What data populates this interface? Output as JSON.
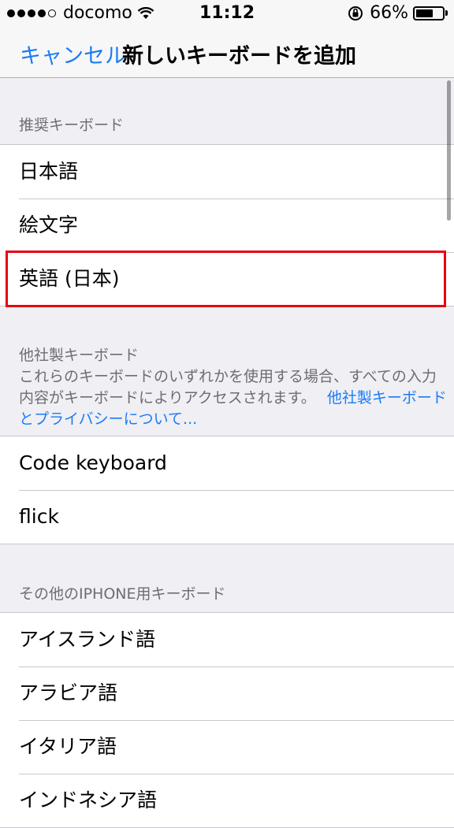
{
  "status_bar": {
    "carrier": "docomo",
    "time": "11:12",
    "battery_percent": "66%",
    "battery_level": 0.66,
    "signal_dots_filled": 4,
    "signal_dots_total": 5
  },
  "nav": {
    "cancel_label": "キャンセル",
    "title": "新しいキーボードを追加"
  },
  "recommended": {
    "header": "推奨キーボード",
    "items": [
      {
        "label": "日本語"
      },
      {
        "label": "絵文字"
      },
      {
        "label": "英語 (日本)"
      }
    ]
  },
  "third_party": {
    "header": "他社製キーボード",
    "description_line1": "これらのキーボードのいずれかを使用する場合、すべての入力",
    "description_line2": "内容がキーボードによりアクセスされます。",
    "link_part1": "他社製キーボード",
    "link_part2": "とプライバシーについて...",
    "items": [
      {
        "label": "Code keyboard"
      },
      {
        "label": "flick"
      }
    ]
  },
  "other": {
    "header": "その他のIPHONE用キーボード",
    "items": [
      {
        "label": "アイスランド語"
      },
      {
        "label": "アラビア語"
      },
      {
        "label": "イタリア語"
      },
      {
        "label": "インドネシア語"
      }
    ]
  },
  "colors": {
    "accent": "#1a7cf5",
    "highlight": "#e60012",
    "background": "#efeff4"
  }
}
